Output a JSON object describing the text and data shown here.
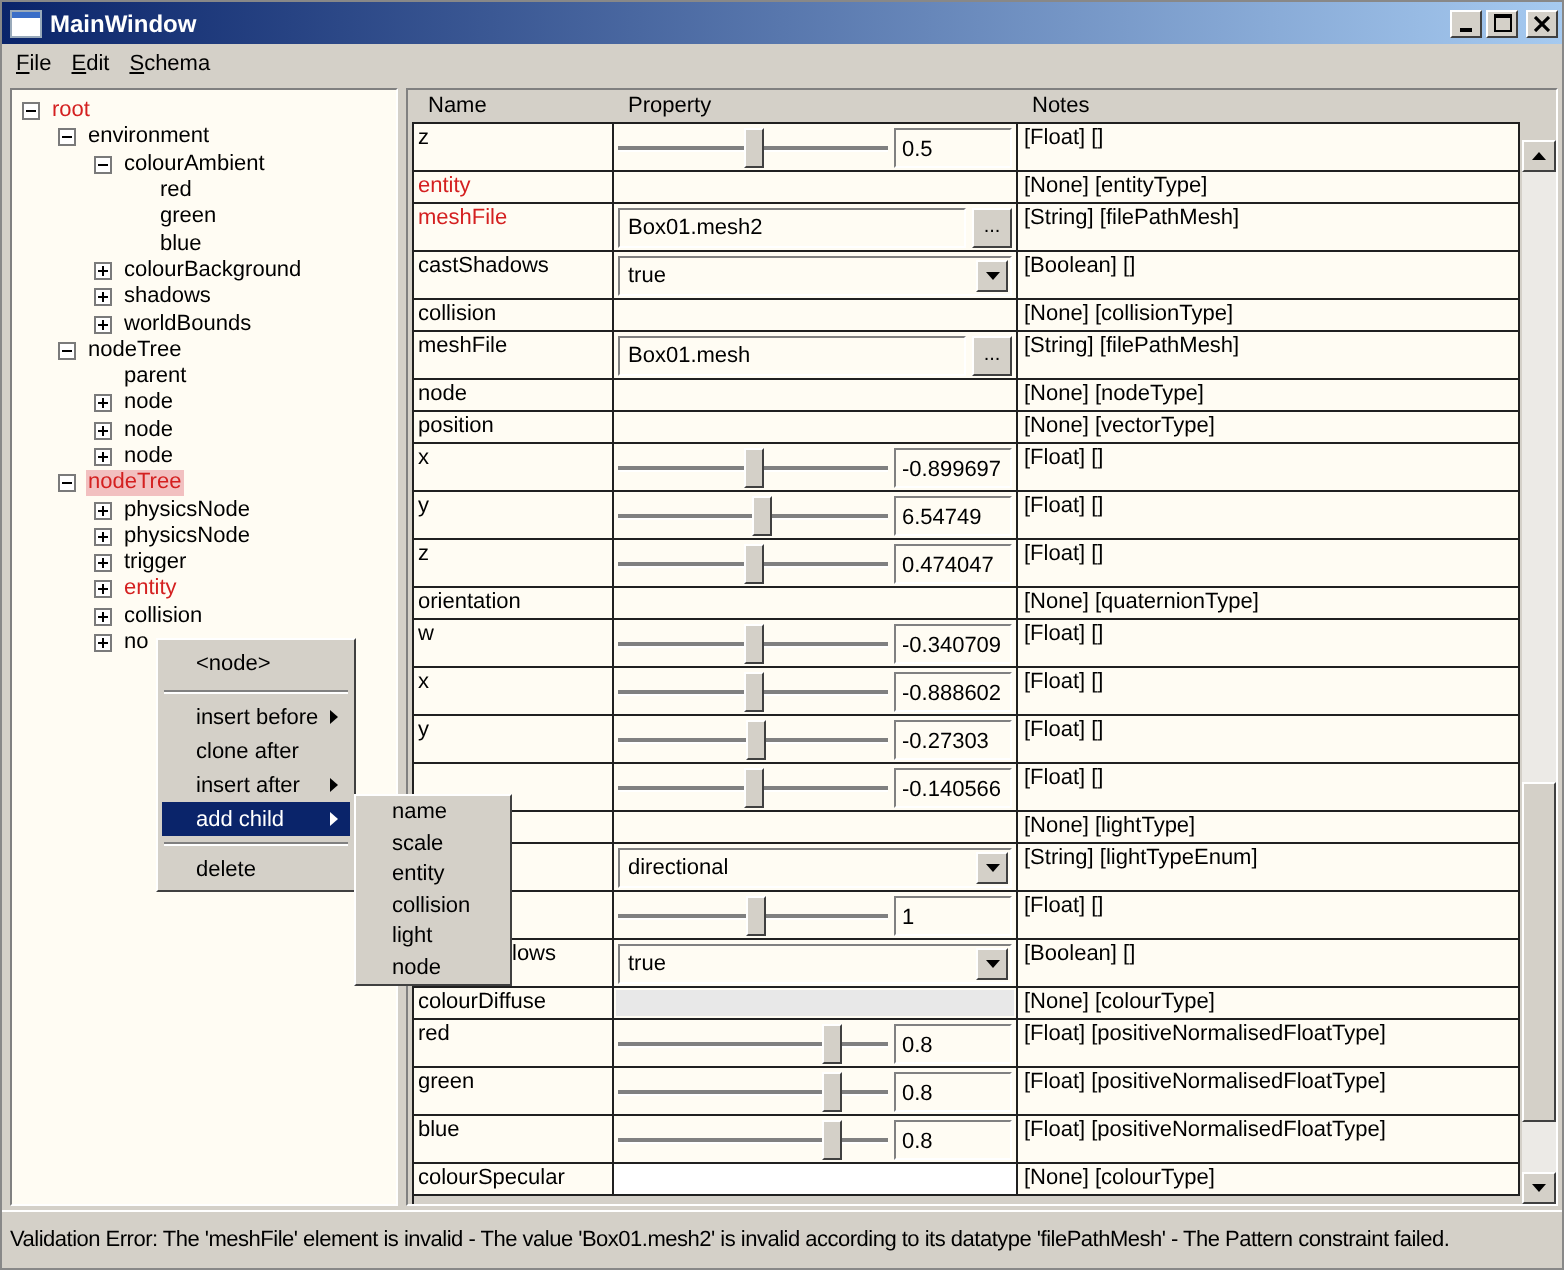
{
  "window": {
    "title": "MainWindow"
  },
  "menu": [
    "File",
    "Edit",
    "Schema"
  ],
  "tree": [
    {
      "label": "root",
      "expanded": true,
      "error": true,
      "selected": false,
      "children": [
        {
          "label": "environment",
          "expanded": true,
          "error": false,
          "selected": false,
          "children": [
            {
              "label": "colourAmbient",
              "expanded": true,
              "error": false,
              "selected": false,
              "children": [
                {
                  "label": "red",
                  "error": false,
                  "selected": false
                },
                {
                  "label": "green",
                  "error": false,
                  "selected": false
                },
                {
                  "label": "blue",
                  "error": false,
                  "selected": false
                }
              ]
            },
            {
              "label": "colourBackground",
              "expanded": false,
              "error": false,
              "selected": false
            },
            {
              "label": "shadows",
              "expanded": false,
              "error": false,
              "selected": false
            },
            {
              "label": "worldBounds",
              "expanded": false,
              "error": false,
              "selected": false
            }
          ]
        },
        {
          "label": "nodeTree",
          "expanded": true,
          "error": false,
          "selected": false,
          "children": [
            {
              "label": "parent",
              "error": false,
              "selected": false
            },
            {
              "label": "node",
              "expanded": false,
              "error": false,
              "selected": false
            },
            {
              "label": "node",
              "expanded": false,
              "error": false,
              "selected": false
            },
            {
              "label": "node",
              "expanded": false,
              "error": false,
              "selected": false
            }
          ]
        },
        {
          "label": "nodeTree",
          "expanded": true,
          "error": true,
          "selected": true,
          "children": [
            {
              "label": "physicsNode",
              "expanded": false,
              "error": false,
              "selected": false
            },
            {
              "label": "physicsNode",
              "expanded": false,
              "error": false,
              "selected": false
            },
            {
              "label": "trigger",
              "expanded": false,
              "error": false,
              "selected": false
            },
            {
              "label": "entity",
              "expanded": false,
              "error": true,
              "selected": false
            },
            {
              "label": "collision",
              "expanded": false,
              "error": false,
              "selected": false
            },
            {
              "label": "no",
              "expanded": false,
              "error": false,
              "selected": false
            }
          ]
        }
      ]
    }
  ],
  "table": {
    "columns": [
      "Name",
      "Property",
      "Notes"
    ],
    "rows": [
      {
        "name": "z",
        "error": false,
        "kind": "slider",
        "level": 0.5,
        "value": "0.5",
        "notes": "[Float] []"
      },
      {
        "name": "entity",
        "error": true,
        "kind": "none",
        "notes": "[None] [entityType]"
      },
      {
        "name": "meshFile",
        "error": true,
        "kind": "file",
        "value": "Box01.mesh2",
        "button": "...",
        "notes": "[String] [filePathMesh]"
      },
      {
        "name": "castShadows",
        "error": false,
        "kind": "combo",
        "value": "true",
        "notes": "[Boolean] []"
      },
      {
        "name": "collision",
        "error": false,
        "kind": "none",
        "notes": "[None] [collisionType]"
      },
      {
        "name": "meshFile",
        "error": false,
        "kind": "file",
        "value": "Box01.mesh",
        "button": "...",
        "notes": "[String] [filePathMesh]"
      },
      {
        "name": "node",
        "error": false,
        "kind": "none",
        "notes": "[None] [nodeType]"
      },
      {
        "name": "position",
        "error": false,
        "kind": "none",
        "notes": "[None] [vectorType]"
      },
      {
        "name": "x",
        "error": false,
        "kind": "slider",
        "level": 0.5,
        "value": "-0.899697",
        "notes": "[Float] []"
      },
      {
        "name": "y",
        "error": false,
        "kind": "slider",
        "level": 0.53,
        "value": "6.54749",
        "notes": "[Float] []"
      },
      {
        "name": "z",
        "error": false,
        "kind": "slider",
        "level": 0.5,
        "value": "0.474047",
        "notes": "[Float] []"
      },
      {
        "name": "orientation",
        "error": false,
        "kind": "none",
        "notes": "[None] [quaternionType]"
      },
      {
        "name": "w",
        "error": false,
        "kind": "slider",
        "level": 0.5,
        "value": "-0.340709",
        "notes": "[Float] []"
      },
      {
        "name": "x",
        "error": false,
        "kind": "slider",
        "level": 0.5,
        "value": "-0.888602",
        "notes": "[Float] []"
      },
      {
        "name": "y",
        "error": false,
        "kind": "slider",
        "level": 0.51,
        "value": "-0.27303",
        "notes": "[Float] []"
      },
      {
        "kind": "slider",
        "level": 0.5,
        "value": "-0.140566",
        "notes": "[Float] []"
      },
      {
        "kind": "none",
        "notes": "[None] [lightType]"
      },
      {
        "kind": "combo",
        "value": "directional",
        "notes": "[String] [lightTypeEnum]"
      },
      {
        "kind": "slider",
        "level": 0.51,
        "value": "1",
        "notes": "[Float] []"
      },
      {
        "name": "lows",
        "name_cut": true,
        "error": false,
        "kind": "combo",
        "value": "true",
        "notes": "[Boolean] []"
      },
      {
        "name": "colourDiffuse",
        "error": false,
        "kind": "shaded",
        "notes": "[None] [colourType]"
      },
      {
        "name": "red",
        "error": false,
        "kind": "slider",
        "level": 0.79,
        "value": "0.8",
        "notes": "[Float] [positiveNormalisedFloatType]"
      },
      {
        "name": "green",
        "error": false,
        "kind": "slider",
        "level": 0.79,
        "value": "0.8",
        "notes": "[Float] [positiveNormalisedFloatType]"
      },
      {
        "name": "blue",
        "error": false,
        "kind": "slider",
        "level": 0.79,
        "value": "0.8",
        "notes": "[Float] [positiveNormalisedFloatType]"
      },
      {
        "name": "colourSpecular",
        "error": false,
        "kind": "white",
        "notes": "[None] [colourType]"
      }
    ]
  },
  "context_menu": {
    "items": [
      {
        "kind": "header",
        "label": "<node>"
      },
      {
        "kind": "separator"
      },
      {
        "kind": "item",
        "label": "insert before",
        "submenu": true,
        "selected": false
      },
      {
        "kind": "item",
        "label": "clone after",
        "submenu": false,
        "selected": false
      },
      {
        "kind": "item",
        "label": "insert after",
        "submenu": true,
        "selected": false
      },
      {
        "kind": "item",
        "label": "add child",
        "submenu": true,
        "selected": true
      },
      {
        "kind": "separator"
      },
      {
        "kind": "item",
        "label": "delete",
        "submenu": false,
        "selected": false
      }
    ],
    "submenu": [
      "name",
      "scale",
      "entity",
      "collision",
      "light",
      "node"
    ]
  },
  "status_bar": "Validation Error: The 'meshFile' element is invalid - The value 'Box01.mesh2' is invalid according to its datatype 'filePathMesh' - The Pattern constraint failed."
}
